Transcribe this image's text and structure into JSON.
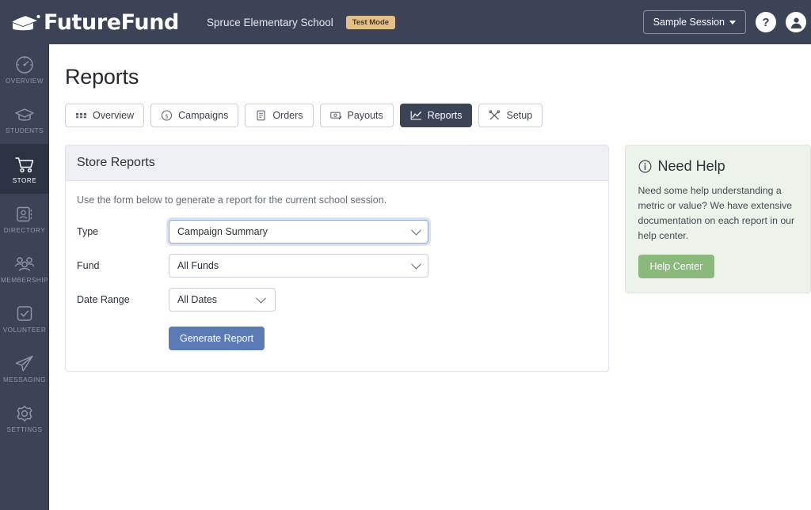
{
  "header": {
    "logo_text": "FutureFund",
    "logo_icon": "graduation-cap-icon",
    "school_name": "Spruce Elementary School",
    "test_badge": "Test Mode",
    "session_label": "Sample Session",
    "help_icon": "question-mark-icon",
    "account_icon": "user-avatar-icon"
  },
  "sidebar": {
    "items": [
      {
        "label": "OVERVIEW",
        "icon": "speedometer-icon",
        "active": false
      },
      {
        "label": "STUDENTS",
        "icon": "graduation-cap-icon",
        "active": false
      },
      {
        "label": "STORE",
        "icon": "shopping-cart-icon",
        "active": true
      },
      {
        "label": "DIRECTORY",
        "icon": "contact-card-icon",
        "active": false
      },
      {
        "label": "MEMBERSHIP",
        "icon": "people-group-icon",
        "active": false
      },
      {
        "label": "VOLUNTEER",
        "icon": "checkbox-icon",
        "active": false
      },
      {
        "label": "MESSAGING",
        "icon": "paper-plane-icon",
        "active": false
      },
      {
        "label": "SETTINGS",
        "icon": "gear-icon",
        "active": false
      }
    ]
  },
  "main": {
    "page_title": "Reports",
    "tabs": [
      {
        "label": "Overview",
        "icon": "grid-icon",
        "active": false
      },
      {
        "label": "Campaigns",
        "icon": "dollar-circle-icon",
        "active": false
      },
      {
        "label": "Orders",
        "icon": "receipt-icon",
        "active": false
      },
      {
        "label": "Payouts",
        "icon": "money-bill-icon",
        "active": false
      },
      {
        "label": "Reports",
        "icon": "line-chart-icon",
        "active": true
      },
      {
        "label": "Setup",
        "icon": "tools-icon",
        "active": false
      }
    ],
    "panel": {
      "title": "Store Reports",
      "description": "Use the form below to generate a report for the current school session.",
      "fields": [
        {
          "label": "Type",
          "value": "Campaign Summary",
          "focused": true
        },
        {
          "label": "Fund",
          "value": "All Funds",
          "focused": false
        },
        {
          "label": "Date Range",
          "value": "All Dates",
          "focused": false
        }
      ],
      "submit_label": "Generate Report"
    }
  },
  "help_card": {
    "icon": "info-circle-icon",
    "title": "Need Help",
    "body": "Need some help understanding a metric or value? We have extensive documentation on each report in our help center.",
    "button_label": "Help Center"
  },
  "colors": {
    "header_bg": "#3d4357",
    "sidebar_active_bg": "#2d3242",
    "tab_active_bg": "#3d4357",
    "panel_head_bg": "#eef0f4",
    "primary_button": "#5a7bb5",
    "help_card_bg": "#edf3ea",
    "help_button": "#8ab97b",
    "test_badge_bg": "#e3c088"
  }
}
